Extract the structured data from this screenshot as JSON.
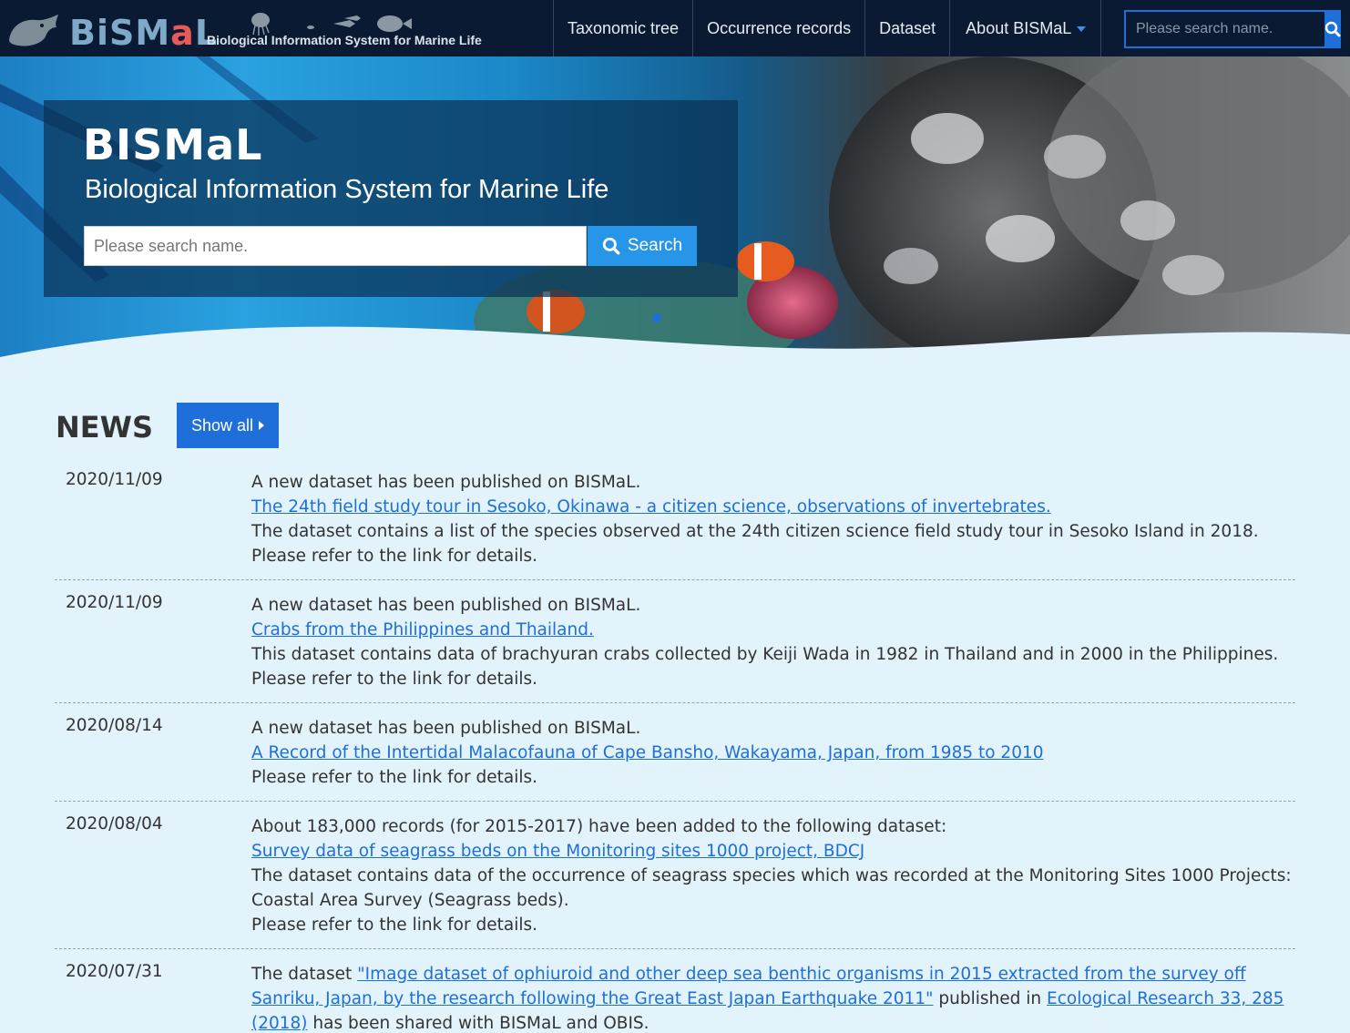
{
  "nav": {
    "logo_word_1": "BiSM",
    "logo_word_2": "a",
    "logo_word_3": "L",
    "logo_tagline": "Biological Information System for Marine Life",
    "items": [
      {
        "label": "Taxonomic tree"
      },
      {
        "label": "Occurrence records"
      },
      {
        "label": "Dataset"
      },
      {
        "label": "About BISMaL"
      }
    ],
    "search_placeholder": "Please search name.",
    "search_icon": "search-icon"
  },
  "hero": {
    "title": "BISMaL",
    "subtitle": "Biological Information System for Marine Life",
    "search_placeholder": "Please search name.",
    "search_button": "Search"
  },
  "news": {
    "title": "NEWS",
    "show_all": "Show all",
    "items": [
      {
        "date": "2020/11/09",
        "line1": "A new dataset has been published on BISMaL.",
        "link": "The 24th field study tour in Sesoko, Okinawa - a citizen science, observations of invertebrates.",
        "line3": "The dataset contains a list of the species observed at the 24th citizen science field study tour in Sesoko Island in 2018.",
        "line4": "Please refer to the link for details."
      },
      {
        "date": "2020/11/09",
        "line1": "A new dataset has been published on BISMaL.",
        "link": "Crabs from the Philippines and Thailand.",
        "line3": "This dataset contains data of brachyuran crabs collected by Keiji Wada in 1982 in Thailand and in 2000 in the Philippines.",
        "line4": "Please refer to the link for details."
      },
      {
        "date": "2020/08/14",
        "line1": "A new dataset has been published on BISMaL.",
        "link": "A Record of the Intertidal Malacofauna of Cape Bansho, Wakayama, Japan, from 1985 to 2010",
        "line4": "Please refer to the link for details."
      },
      {
        "date": "2020/08/04",
        "line1": "About 183,000 records (for 2015-2017) have been added to the following dataset:",
        "link": "Survey data of seagrass beds on the Monitoring sites 1000 project, BDCJ",
        "line3": "The dataset contains data of the occurrence of seagrass species which was recorded at the Monitoring Sites 1000 Projects: Coastal Area Survey (Seagrass beds).",
        "line4": "Please refer to the link for details."
      },
      {
        "date": "2020/07/31",
        "prefix": "The dataset ",
        "link": "\"Image dataset of ophiuroid and other deep sea benthic organisms in 2015 extracted from the survey off Sanriku, Japan, by the research following the Great East Japan Earthquake 2011\"",
        "middle": " published in ",
        "link2": "Ecological Research 33, 285 (2018)",
        "suffix": " has been shared with BISMaL and OBIS."
      }
    ]
  }
}
